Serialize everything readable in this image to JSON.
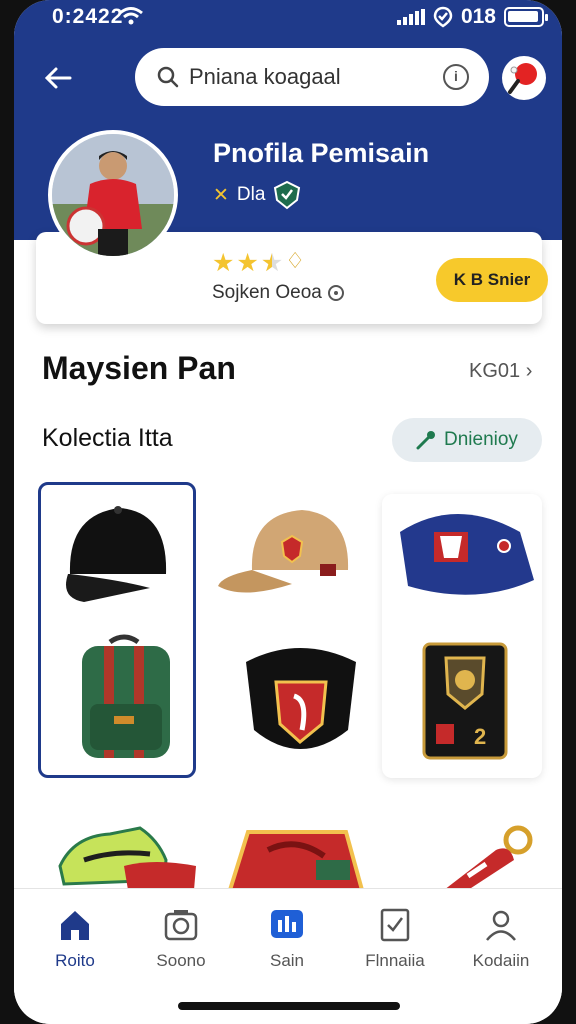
{
  "status": {
    "time": "0:2422",
    "carrier": "018"
  },
  "search": {
    "placeholder": "Pniana koagaal"
  },
  "profile": {
    "title": "Pnofila Pemisain",
    "subtitle": "Dla",
    "card_subtitle": "Sojken Oeoa",
    "rating": 2.5,
    "rating_max": 4,
    "action_label": "K B Snier"
  },
  "section": {
    "title": "Maysien Pan",
    "link": "KG01"
  },
  "collection": {
    "title": "Kolectia Itta",
    "filter_label": "Dnienioy"
  },
  "items": [
    {
      "icon": "black-cap-icon"
    },
    {
      "icon": "tan-cap-icon"
    },
    {
      "icon": "blue-hat-icon"
    },
    {
      "icon": "green-backpack-icon"
    },
    {
      "icon": "shield-pouch-icon"
    },
    {
      "icon": "badge-card-icon"
    },
    {
      "icon": "sneakers-icon"
    },
    {
      "icon": "red-scarf-icon"
    },
    {
      "icon": "keychain-icon"
    }
  ],
  "nav": [
    {
      "label": "Roito",
      "icon": "home-icon",
      "active": true
    },
    {
      "label": "Soono",
      "icon": "camera-icon",
      "active": false
    },
    {
      "label": "Sain",
      "icon": "chart-icon",
      "active": false
    },
    {
      "label": "Flnnaiia",
      "icon": "document-check-icon",
      "active": false
    },
    {
      "label": "Kodaiin",
      "icon": "profile-icon",
      "active": false
    }
  ],
  "colors": {
    "primary": "#1f3a8a",
    "accent": "#f7c92b",
    "filter_text": "#1f7a4f"
  }
}
